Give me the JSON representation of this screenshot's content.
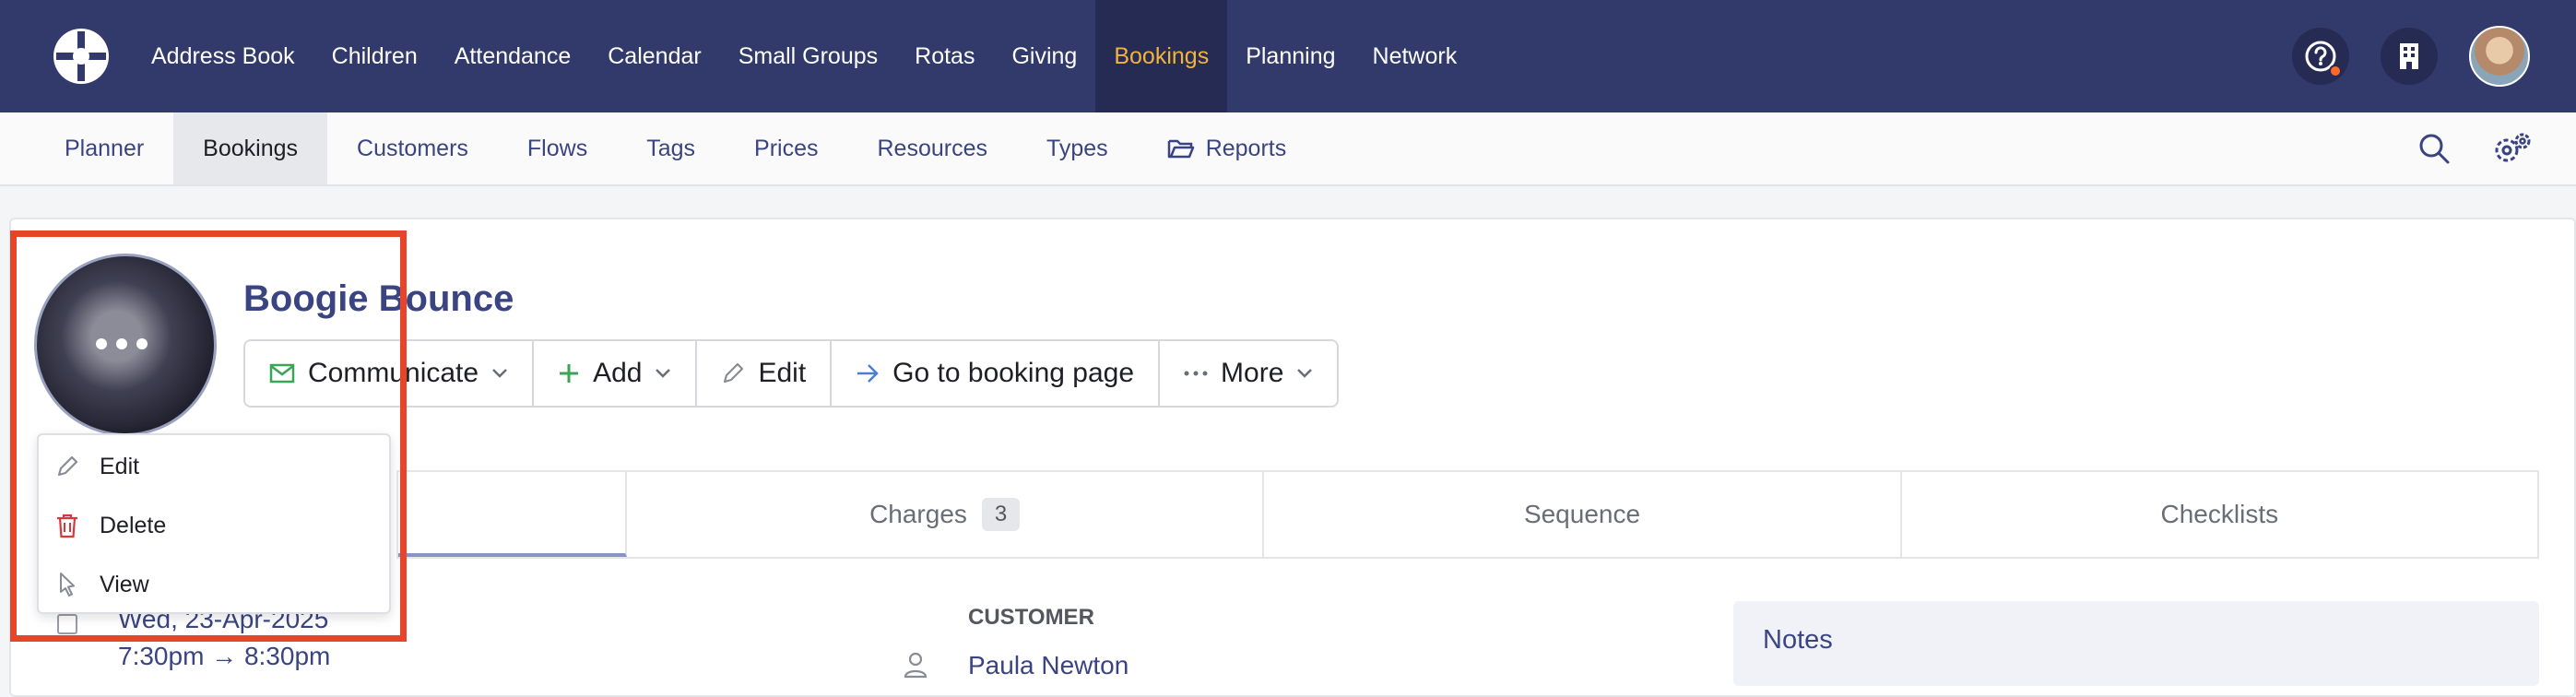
{
  "topnav": {
    "items": [
      "Address Book",
      "Children",
      "Attendance",
      "Calendar",
      "Small Groups",
      "Rotas",
      "Giving",
      "Bookings",
      "Planning",
      "Network"
    ],
    "active": "Bookings"
  },
  "subnav": {
    "items": [
      "Planner",
      "Bookings",
      "Customers",
      "Flows",
      "Tags",
      "Prices",
      "Resources",
      "Types",
      "Reports"
    ],
    "active": "Bookings"
  },
  "booking": {
    "title": "Boogie Bounce",
    "actions": {
      "communicate": "Communicate",
      "add": "Add",
      "edit": "Edit",
      "go_to_booking_page": "Go to booking page",
      "more": "More"
    }
  },
  "tabs": {
    "charges": "Charges",
    "charges_count": "3",
    "sequence": "Sequence",
    "checklists": "Checklists"
  },
  "image_menu": {
    "edit": "Edit",
    "delete": "Delete",
    "view": "View"
  },
  "details": {
    "date": "Wed, 23-Apr-2025",
    "time": "7:30pm → 8:30pm",
    "customer_label": "CUSTOMER",
    "customer_name": "Paula Newton",
    "notes_label": "Notes"
  },
  "colors": {
    "nav_bg": "#323a6b",
    "nav_active_text": "#f2b33d",
    "link": "#3a4483",
    "highlight": "#e8442a",
    "notification_dot": "#ff6a2b"
  }
}
